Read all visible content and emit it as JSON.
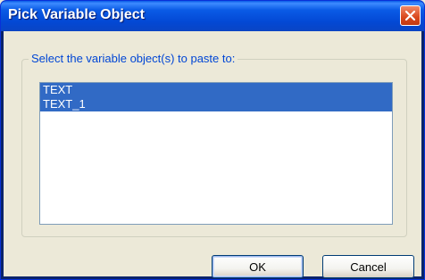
{
  "dialog": {
    "title": "Pick Variable Object"
  },
  "group": {
    "label": "Select the variable object(s) to paste to:"
  },
  "list": {
    "items": [
      {
        "label": "TEXT",
        "selected": true
      },
      {
        "label": "TEXT_1",
        "selected": true
      }
    ]
  },
  "buttons": {
    "ok_label": "OK",
    "cancel_label": "Cancel"
  },
  "icons": {
    "close": "close-icon"
  },
  "colors": {
    "title_bar": "#0a5be6",
    "selection": "#316ac5",
    "close_button": "#d9471c",
    "group_label": "#0046d5"
  }
}
